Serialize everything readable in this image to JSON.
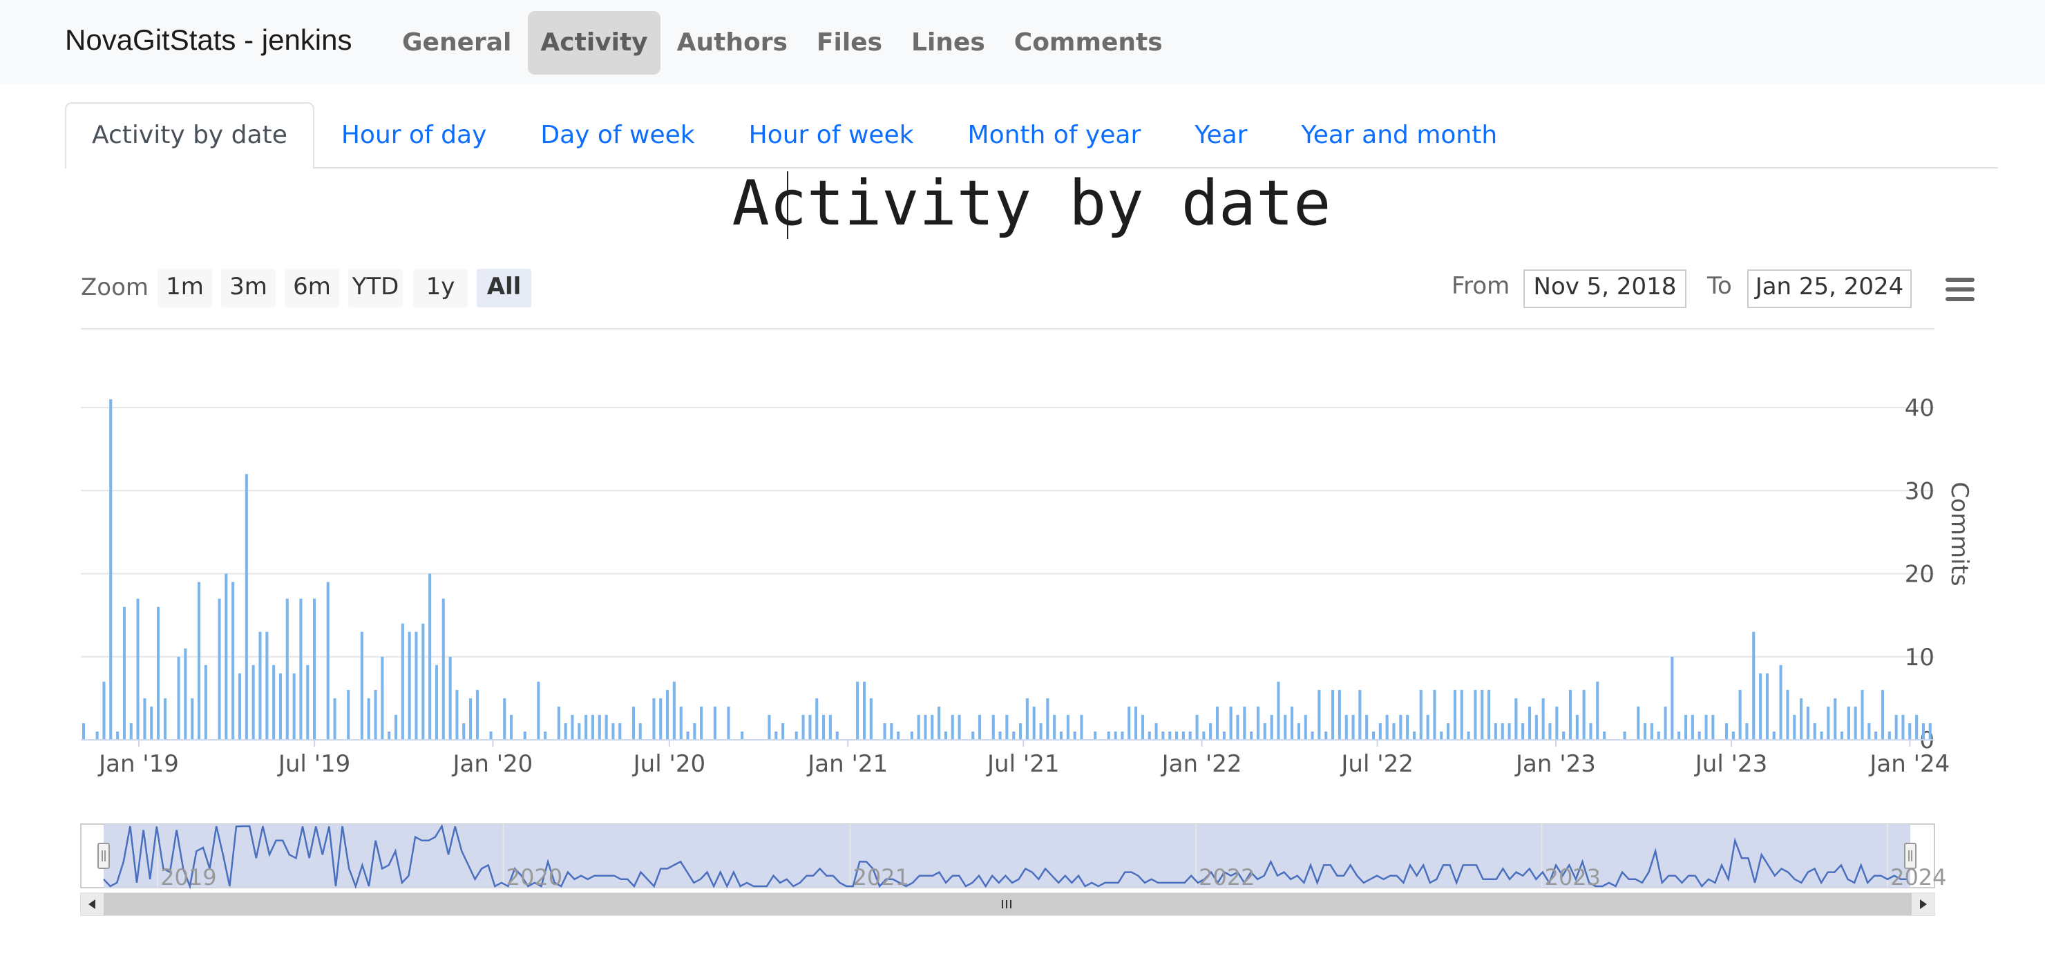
{
  "navbar": {
    "brand": "NovaGitStats - jenkins",
    "links": [
      "General",
      "Activity",
      "Authors",
      "Files",
      "Lines",
      "Comments"
    ],
    "active": "Activity"
  },
  "tabs": {
    "items": [
      "Activity by date",
      "Hour of day",
      "Day of week",
      "Hour of week",
      "Month of year",
      "Year",
      "Year and month"
    ],
    "active": "Activity by date"
  },
  "colors": {
    "bar": "#7cb5ec",
    "navigator_line": "#4a6fbf",
    "navigator_mask": "#d4daee",
    "link": "#0d6efd"
  },
  "chart_data": {
    "type": "bar",
    "title": "Activity by date",
    "ylabel": "Commits",
    "ylim": [
      0,
      40
    ],
    "yticks": [
      0,
      10,
      20,
      30,
      40
    ],
    "grid": true,
    "x_tick_labels": [
      "Jan '19",
      "Jul '19",
      "Jan '20",
      "Jul '20",
      "Jan '21",
      "Jul '21",
      "Jan '22",
      "Jul '22",
      "Jan '23",
      "Jul '23",
      "Jan '24"
    ],
    "range_selector": {
      "zoom_label": "Zoom",
      "buttons": [
        "1m",
        "3m",
        "6m",
        "YTD",
        "1y",
        "All"
      ],
      "selected": "All",
      "from_label": "From",
      "from_value": "Nov 5, 2018",
      "to_label": "To",
      "to_value": "Jan 25, 2024"
    },
    "navigator_labels": [
      "2019",
      "2020",
      "2021",
      "2022",
      "2023",
      "2024"
    ],
    "x_range": [
      "2018-11-05",
      "2024-01-25"
    ],
    "x_interval": "weekly",
    "values": [
      2,
      0,
      1,
      7,
      41,
      1,
      16,
      2,
      17,
      5,
      4,
      16,
      5,
      0,
      10,
      11,
      5,
      19,
      9,
      0,
      17,
      20,
      19,
      8,
      32,
      9,
      13,
      13,
      9,
      8,
      17,
      8,
      17,
      9,
      17,
      0,
      19,
      5,
      0,
      6,
      0,
      13,
      5,
      6,
      10,
      1,
      3,
      14,
      13,
      13,
      14,
      20,
      9,
      17,
      10,
      6,
      2,
      5,
      6,
      0,
      1,
      0,
      5,
      3,
      0,
      1,
      0,
      7,
      1,
      0,
      4,
      2,
      3,
      2,
      3,
      3,
      3,
      3,
      2,
      2,
      0,
      4,
      2,
      0,
      5,
      5,
      6,
      7,
      4,
      1,
      2,
      4,
      0,
      4,
      0,
      4,
      0,
      1,
      0,
      0,
      0,
      3,
      1,
      2,
      0,
      1,
      3,
      3,
      5,
      3,
      3,
      1,
      0,
      0,
      7,
      7,
      5,
      0,
      2,
      2,
      1,
      0,
      1,
      3,
      3,
      3,
      4,
      1,
      3,
      3,
      0,
      1,
      3,
      0,
      3,
      1,
      3,
      1,
      2,
      5,
      4,
      2,
      5,
      3,
      1,
      3,
      1,
      3,
      0,
      1,
      0,
      1,
      1,
      1,
      4,
      4,
      3,
      1,
      2,
      1,
      1,
      1,
      1,
      1,
      3,
      1,
      2,
      4,
      1,
      4,
      3,
      4,
      1,
      4,
      2,
      3,
      7,
      3,
      4,
      2,
      3,
      1,
      6,
      1,
      6,
      6,
      3,
      3,
      6,
      3,
      1,
      2,
      3,
      2,
      3,
      3,
      1,
      6,
      3,
      6,
      1,
      2,
      6,
      6,
      1,
      6,
      6,
      6,
      2,
      2,
      2,
      5,
      2,
      4,
      3,
      5,
      2,
      4,
      1,
      6,
      3,
      6,
      2,
      7,
      1,
      0,
      0,
      1,
      0,
      4,
      2,
      2,
      1,
      4,
      10,
      1,
      3,
      3,
      1,
      3,
      3,
      0,
      2,
      1,
      6,
      2,
      13,
      8,
      8,
      1,
      9,
      6,
      3,
      5,
      4,
      2,
      1,
      4,
      5,
      1,
      4,
      4,
      6,
      2,
      1,
      6,
      1,
      3,
      3,
      2,
      3,
      2,
      2,
      5,
      3,
      5,
      2,
      3,
      1,
      3,
      4,
      1,
      1,
      0,
      0,
      2
    ]
  }
}
